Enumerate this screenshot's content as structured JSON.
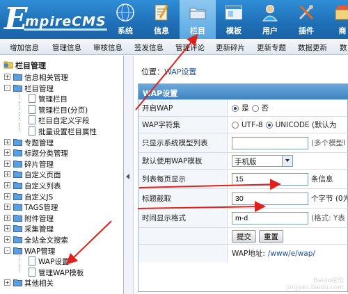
{
  "app": {
    "logo_text": "mpireCMS",
    "logo_letter": "E"
  },
  "nav": [
    {
      "label": "系统",
      "icon": "globe-icon"
    },
    {
      "label": "信息",
      "icon": "notepad-icon"
    },
    {
      "label": "栏目",
      "icon": "folder-icon",
      "active": true
    },
    {
      "label": "模板",
      "icon": "window-icon"
    },
    {
      "label": "用户",
      "icon": "user-icon"
    },
    {
      "label": "插件",
      "icon": "tools-icon"
    },
    {
      "label": "商",
      "icon": "shop-icon"
    }
  ],
  "submenu": [
    "增加信息",
    "管理信息",
    "审核信息",
    "签发信息",
    "管理评论",
    "更新碎片",
    "更新专题",
    "数据更新",
    "数"
  ],
  "tree": {
    "title": "栏目管理",
    "items": [
      {
        "label": "信息相关管理",
        "level": 0,
        "type": "folder",
        "exp": "+"
      },
      {
        "label": "栏目管理",
        "level": 0,
        "type": "folder",
        "exp": "-"
      },
      {
        "label": "管理栏目",
        "level": 1,
        "type": "doc"
      },
      {
        "label": "管理栏目(分页)",
        "level": 1,
        "type": "doc"
      },
      {
        "label": "栏目自定义字段",
        "level": 1,
        "type": "doc"
      },
      {
        "label": "批量设置栏目属性",
        "level": 1,
        "type": "doc"
      },
      {
        "label": "专题管理",
        "level": 0,
        "type": "folder",
        "exp": "+"
      },
      {
        "label": "标题分类管理",
        "level": 0,
        "type": "folder",
        "exp": "+"
      },
      {
        "label": "碎片管理",
        "level": 0,
        "type": "folder",
        "exp": "+"
      },
      {
        "label": "自定义页面",
        "level": 0,
        "type": "folder",
        "exp": "+"
      },
      {
        "label": "自定义列表",
        "level": 0,
        "type": "folder",
        "exp": "+"
      },
      {
        "label": "自定义JS",
        "level": 0,
        "type": "folder",
        "exp": "+"
      },
      {
        "label": "TAGS管理",
        "level": 0,
        "type": "folder",
        "exp": "+"
      },
      {
        "label": "附件管理",
        "level": 0,
        "type": "folder",
        "exp": "+"
      },
      {
        "label": "采集管理",
        "level": 0,
        "type": "folder",
        "exp": "+"
      },
      {
        "label": "全站全文搜索",
        "level": 0,
        "type": "folder",
        "exp": "+"
      },
      {
        "label": "WAP管理",
        "level": 0,
        "type": "folder",
        "exp": "-"
      },
      {
        "label": "WAP设置",
        "level": 1,
        "type": "doc"
      },
      {
        "label": "管理WAP模板",
        "level": 1,
        "type": "doc"
      },
      {
        "label": "其他相关",
        "level": 0,
        "type": "folder",
        "exp": "+"
      }
    ]
  },
  "main": {
    "crumb_prefix": "位置：",
    "crumb_link": "WAP设置",
    "form_title": "WAP设置",
    "rows": {
      "open_wap": {
        "label": "开启WAP",
        "opt_yes": "是",
        "opt_no": "否"
      },
      "charset": {
        "label": "WAP字符集",
        "opt_utf8": "UTF-8",
        "opt_unicode": "UNICODE (默认为"
      },
      "models": {
        "label": "只显示系统模型列表",
        "value": "",
        "hint": "(多个模型I"
      },
      "template": {
        "label": "默认使用WAP模板",
        "value": "手机版"
      },
      "per_page": {
        "label": "列表每页显示",
        "value": "15",
        "unit": "条信息"
      },
      "title_cut": {
        "label": "标题截取",
        "value": "30",
        "unit": "个字节 (0为"
      },
      "time_fmt": {
        "label": "时间显示格式",
        "value": "m-d",
        "hint": "(格式: Y表"
      }
    },
    "submit_label": "提交",
    "reset_label": "重置",
    "wap_addr_label": "WAP地址:",
    "wap_addr_value": "/www/e/wap/"
  },
  "watermark": {
    "line1": "Baidu经验",
    "line2": "jingyan.baidu.com"
  },
  "colors": {
    "banner": "#1f6fb6",
    "annotation": "#e0201a"
  }
}
